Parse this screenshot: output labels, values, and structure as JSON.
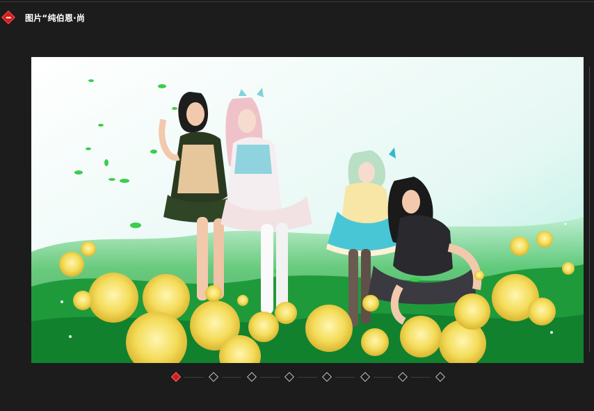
{
  "header": {
    "title": "图片“纯伯恩·尚",
    "collapse_icon": "minus-diamond-icon",
    "accent_color": "#d21c1c"
  },
  "viewer": {
    "image_subject": "four-characters-in-rose-garden",
    "background_tint": "#e8faf6",
    "foliage_color": "#2aa63f",
    "rose_color": "#f4dc5a"
  },
  "pager": {
    "page_count": 8,
    "active_index": 0,
    "active_color": "#d21c1c",
    "inactive_color": "#bdbdbd"
  }
}
